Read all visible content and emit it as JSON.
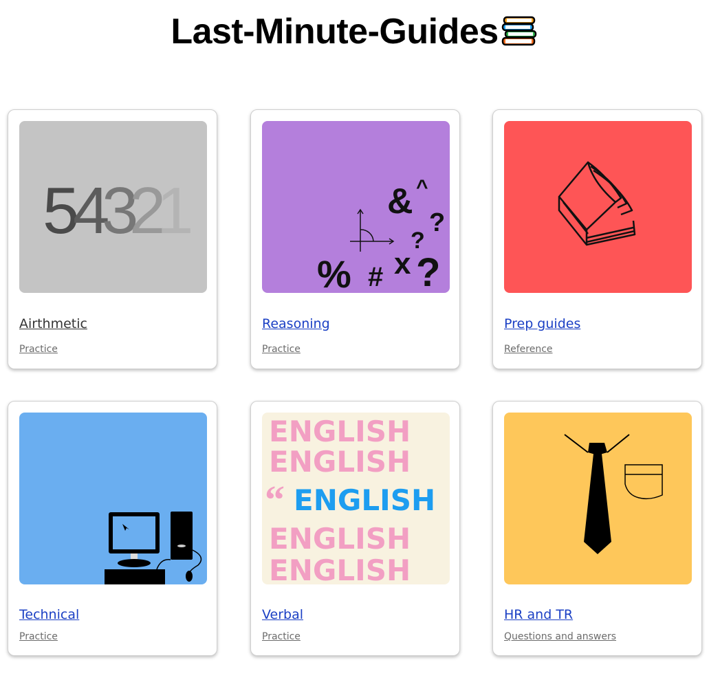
{
  "header": {
    "title": "Last-Minute-Guides",
    "icon": "books-stack-icon"
  },
  "cards": [
    {
      "title": "Airthmetic",
      "subtitle": "Practice",
      "image": "numbers-54321-image",
      "bg": "#c4c4c4",
      "digits": [
        "5",
        "4",
        "3",
        "2",
        "1"
      ]
    },
    {
      "title": "Reasoning",
      "subtitle": "Practice",
      "image": "math-symbols-image",
      "bg": "#b47fdc"
    },
    {
      "title": "Prep guides",
      "subtitle": "Reference",
      "image": "open-book-image",
      "bg": "#fe5556"
    },
    {
      "title": "Technical",
      "subtitle": "Practice",
      "image": "desktop-computer-image",
      "bg": "#6aaef0"
    },
    {
      "title": "Verbal",
      "subtitle": "Practice",
      "image": "english-words-image",
      "bg": "#f8f2e0",
      "words": [
        "ENGLISH",
        "ENGLISH",
        "ENGLISH",
        "ENGLISH",
        "ENGLISH"
      ]
    },
    {
      "title": "HR and TR",
      "subtitle": "Questions and answers",
      "image": "shirt-tie-image",
      "bg": "#fec75a"
    }
  ]
}
